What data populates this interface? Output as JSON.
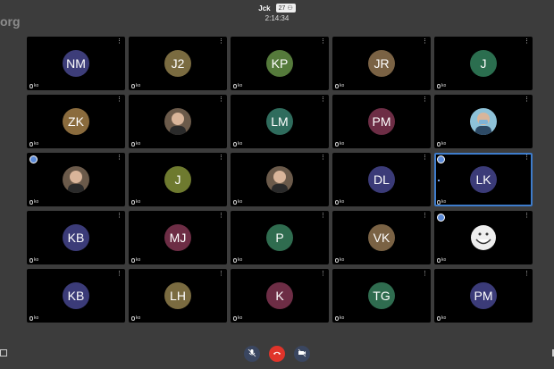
{
  "watermark": "org",
  "meeting": {
    "title": "Jck",
    "participant_count": "27",
    "timer": "2:14:34"
  },
  "tile_status": "ko",
  "colors": {
    "accent": "#3e7ccb",
    "end_call": "#e0342a"
  },
  "tiles": [
    {
      "initials": "NM",
      "color": "#3d3d79"
    },
    {
      "initials": "J2",
      "color": "#7a6b40"
    },
    {
      "initials": "KP",
      "color": "#557a3b"
    },
    {
      "initials": "JR",
      "color": "#7a6244"
    },
    {
      "initials": "J",
      "color": "#2b6e4f"
    },
    {
      "initials": "ZK",
      "color": "#8a6b3d"
    },
    {
      "initials": "",
      "color": "#444",
      "image": "person-photo"
    },
    {
      "initials": "LM",
      "color": "#2f6c5d"
    },
    {
      "initials": "PM",
      "color": "#6d2d45"
    },
    {
      "initials": "",
      "color": "#444",
      "image": "person-photo-mask"
    },
    {
      "initials": "",
      "color": "#444",
      "image": "person-photo"
    },
    {
      "initials": "J",
      "color": "#6e7a2f"
    },
    {
      "initials": "",
      "color": "#444",
      "image": "person-photo"
    },
    {
      "initials": "DL",
      "color": "#3b3b78"
    },
    {
      "initials": "LK",
      "color": "#3b3b78"
    },
    {
      "initials": "KB",
      "color": "#3b3b78"
    },
    {
      "initials": "MJ",
      "color": "#6d2d45"
    },
    {
      "initials": "P",
      "color": "#2f6c4f"
    },
    {
      "initials": "VK",
      "color": "#7a6244"
    },
    {
      "initials": "",
      "color": "#ddd",
      "image": "trollface"
    },
    {
      "initials": "KB",
      "color": "#3b3b78"
    },
    {
      "initials": "LH",
      "color": "#7a6b40"
    },
    {
      "initials": "K",
      "color": "#6d2d45"
    },
    {
      "initials": "TG",
      "color": "#2f6c4f"
    },
    {
      "initials": "PM",
      "color": "#3b3b78"
    }
  ],
  "toolbar": {
    "mic_icon": "mic-off-icon",
    "hangup_icon": "hangup-icon",
    "camera_icon": "camera-off-icon"
  }
}
